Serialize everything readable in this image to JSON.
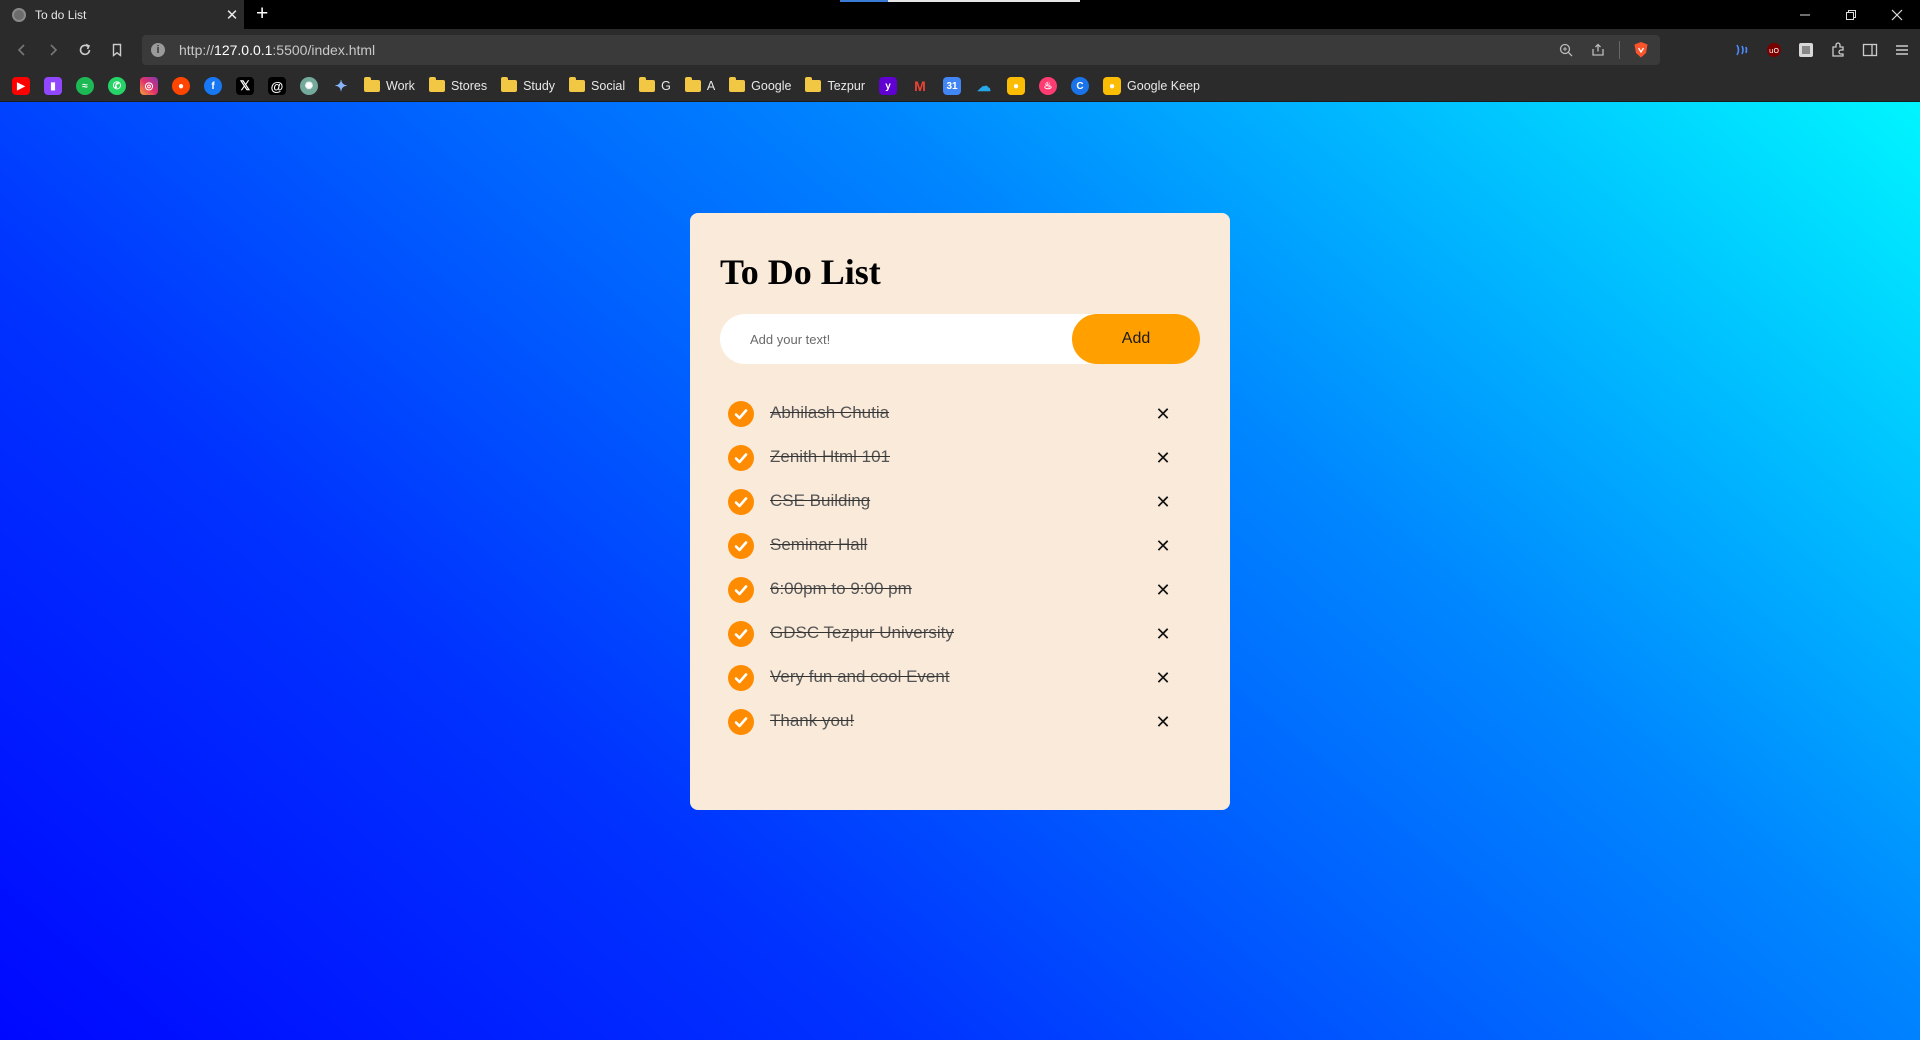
{
  "browser": {
    "tab": {
      "title": "To do List"
    },
    "url": {
      "prefix": "http://",
      "host": "127.0.0.1",
      "path": ":5500/index.html"
    },
    "bookmarks": {
      "icons_left": [
        "youtube-icon",
        "twitch-icon",
        "spotify-icon",
        "whatsapp-icon",
        "instagram-icon",
        "reddit-icon",
        "facebook-icon",
        "x-icon",
        "threads-icon",
        "chatgpt-icon",
        "gemini-icon"
      ],
      "folders": [
        "Work",
        "Stores",
        "Study",
        "Social",
        "G",
        "A",
        "Google",
        "Tezpur"
      ],
      "icons_right": [
        "yahoo-icon",
        "gmail-icon",
        "calendar-icon",
        "onedrive-icon",
        "keep-icon",
        "tinder-icon",
        "c-icon"
      ],
      "last_label": "Google Keep"
    }
  },
  "app": {
    "title": "To Do List",
    "input": {
      "placeholder": "Add your text!",
      "value": ""
    },
    "add_label": "Add",
    "delete_glyph": "✕",
    "todos": [
      {
        "text": "Abhilash Chutia",
        "done": true
      },
      {
        "text": "Zenith Html 101",
        "done": true
      },
      {
        "text": "CSE Building",
        "done": true
      },
      {
        "text": "Seminar Hall",
        "done": true
      },
      {
        "text": "6:00pm to 9:00 pm",
        "done": true
      },
      {
        "text": "GDSC Tezpur University",
        "done": true
      },
      {
        "text": "Very fun and cool Event",
        "done": true
      },
      {
        "text": "Thank you!",
        "done": true
      }
    ]
  },
  "colors": {
    "accent": "#ff9f00",
    "check": "#ff8c00",
    "card_bg": "#faeada",
    "gradient_start": "#00f5ff",
    "gradient_end": "#0008ff"
  }
}
